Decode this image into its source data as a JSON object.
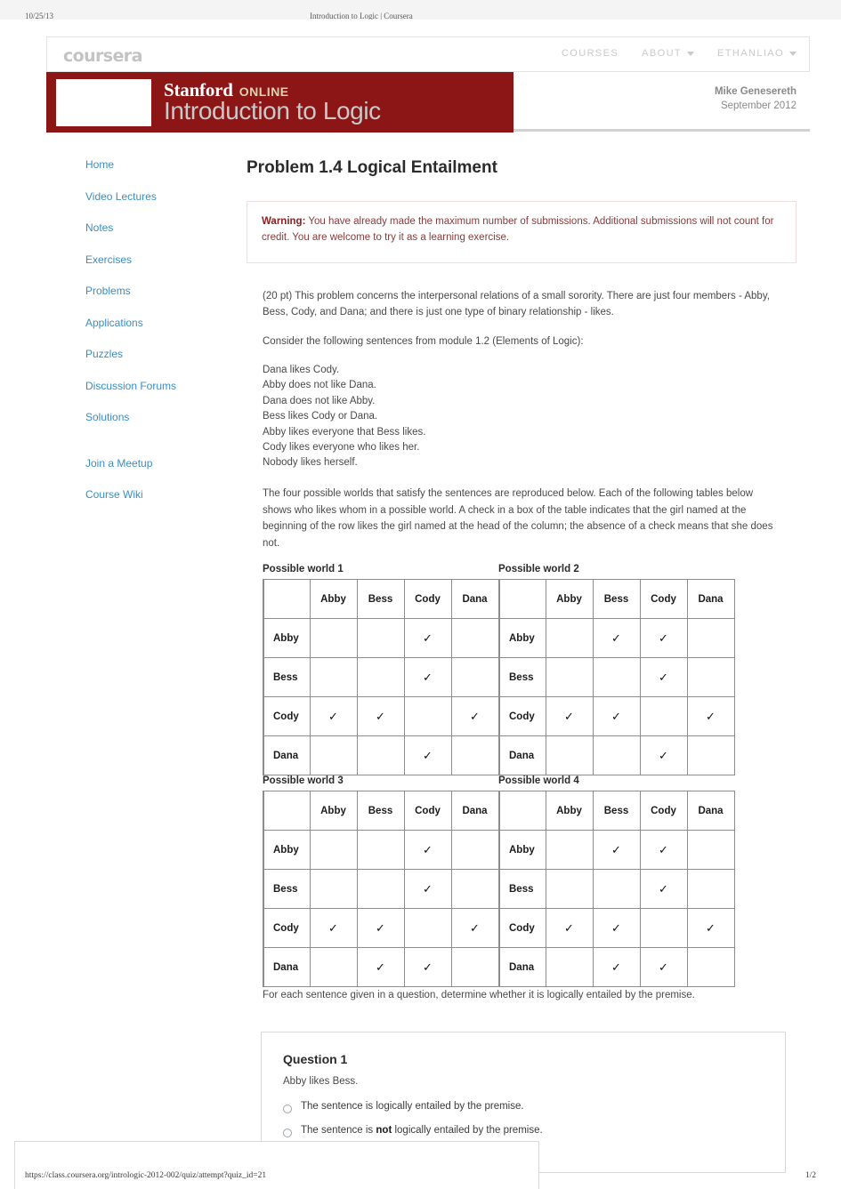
{
  "print_header": {
    "left": "10/25/13",
    "center": "Introduction to Logic | Coursera"
  },
  "print_footer": {
    "url": "https://class.coursera.org/intrologic-2012-002/quiz/attempt?quiz_id=21",
    "page": "1/2"
  },
  "topbar": {
    "logo": "coursera",
    "nav": [
      {
        "label": "COURSES",
        "has_caret": false
      },
      {
        "label": "ABOUT",
        "has_caret": true
      },
      {
        "label": "ETHANLIAO",
        "has_caret": true
      }
    ]
  },
  "banner": {
    "stanford": "Stanford",
    "online": "ONLINE",
    "course_title": "Introduction to Logic",
    "color": "#8c1616",
    "instructor": "Mike Genesereth",
    "date": "September 2012"
  },
  "sidebar": {
    "items": [
      {
        "label": "Home"
      },
      {
        "label": "Video Lectures"
      },
      {
        "label": "Notes"
      },
      {
        "label": "Exercises"
      },
      {
        "label": "Problems"
      },
      {
        "label": "Applications"
      },
      {
        "label": "Puzzles"
      },
      {
        "label": "Discussion Forums"
      },
      {
        "label": "Solutions"
      }
    ],
    "extra_items": [
      {
        "label": "Join a Meetup"
      },
      {
        "label": "Course Wiki"
      }
    ]
  },
  "main": {
    "title": "Problem 1.4 Logical Entailment",
    "warning_label": "Warning:",
    "warning_text": " You have already made the maximum number of submissions. Additional submissions will not count for credit. You are welcome to try it as a learning exercise.",
    "warning_color": "#8a3a3a",
    "intro_paragraph": "(20 pt) This problem concerns the interpersonal relations of a small sorority. There are just four members - Abby, Bess, Cody, and Dana; and there is just one type of binary relationship - likes.",
    "consider_paragraph": "Consider the following sentences from module 1.2 (Elements of Logic):",
    "sentences": [
      "Dana likes Cody.",
      "Abby does not like Dana.",
      "Dana does not like Abby.",
      "Bess likes Cody or Dana.",
      "Abby likes everyone that Bess likes.",
      "Cody likes everyone who likes her.",
      "Nobody likes herself."
    ],
    "worlds_paragraph": "The four possible worlds that satisfy the sentences are reproduced below. Each of the following tables below shows who likes whom in a possible world. A check in a box of the table indicates that the girl named at the beginning of the row likes the girl named at the head of the column; the absence of a check means that she does not.",
    "after_tables_paragraph": "For each sentence given in a question, determine whether it is logically entailed by the premise.",
    "check_glyph": "✓"
  },
  "worlds": [
    {
      "caption": "Possible world 1",
      "columns": [
        "Abby",
        "Bess",
        "Cody",
        "Dana"
      ],
      "rows": [
        {
          "label": "Abby",
          "checks": [
            false,
            false,
            true,
            false
          ]
        },
        {
          "label": "Bess",
          "checks": [
            false,
            false,
            true,
            false
          ]
        },
        {
          "label": "Cody",
          "checks": [
            true,
            true,
            false,
            true
          ]
        },
        {
          "label": "Dana",
          "checks": [
            false,
            false,
            true,
            false
          ]
        }
      ]
    },
    {
      "caption": "Possible world 2",
      "columns": [
        "Abby",
        "Bess",
        "Cody",
        "Dana"
      ],
      "rows": [
        {
          "label": "Abby",
          "checks": [
            false,
            true,
            true,
            false
          ]
        },
        {
          "label": "Bess",
          "checks": [
            false,
            false,
            true,
            false
          ]
        },
        {
          "label": "Cody",
          "checks": [
            true,
            true,
            false,
            true
          ]
        },
        {
          "label": "Dana",
          "checks": [
            false,
            false,
            true,
            false
          ]
        }
      ]
    },
    {
      "caption": "Possible world 3",
      "columns": [
        "Abby",
        "Bess",
        "Cody",
        "Dana"
      ],
      "rows": [
        {
          "label": "Abby",
          "checks": [
            false,
            false,
            true,
            false
          ]
        },
        {
          "label": "Bess",
          "checks": [
            false,
            false,
            true,
            false
          ]
        },
        {
          "label": "Cody",
          "checks": [
            true,
            true,
            false,
            true
          ]
        },
        {
          "label": "Dana",
          "checks": [
            false,
            true,
            true,
            false
          ]
        }
      ]
    },
    {
      "caption": "Possible world 4",
      "columns": [
        "Abby",
        "Bess",
        "Cody",
        "Dana"
      ],
      "rows": [
        {
          "label": "Abby",
          "checks": [
            false,
            true,
            true,
            false
          ]
        },
        {
          "label": "Bess",
          "checks": [
            false,
            false,
            true,
            false
          ]
        },
        {
          "label": "Cody",
          "checks": [
            true,
            true,
            false,
            true
          ]
        },
        {
          "label": "Dana",
          "checks": [
            false,
            true,
            true,
            false
          ]
        }
      ]
    }
  ],
  "question": {
    "title": "Question 1",
    "prompt": "Abby likes Bess.",
    "options": [
      {
        "pre": "The sentence is logically entailed by the premise.",
        "bold": "",
        "post": "",
        "selected": false
      },
      {
        "pre": "The sentence is ",
        "bold": "not",
        "post": " logically entailed by the premise.",
        "selected": false
      }
    ]
  }
}
